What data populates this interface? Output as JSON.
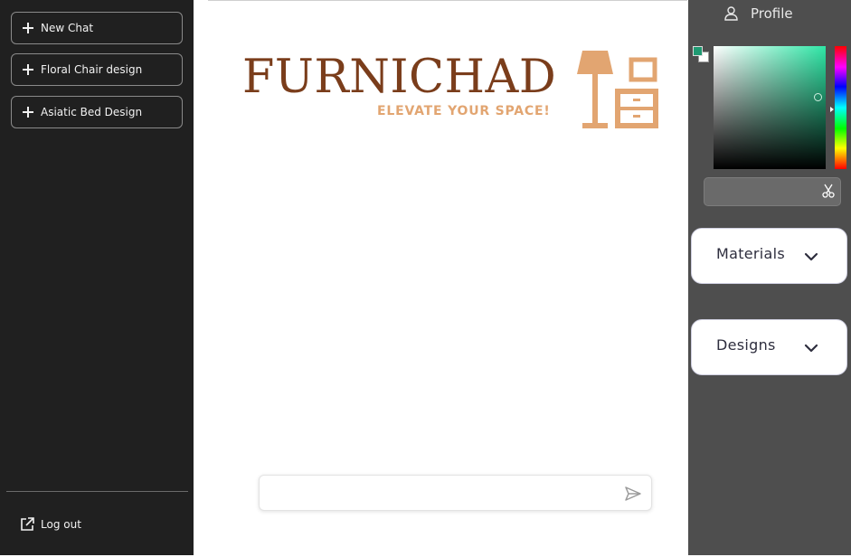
{
  "sidebar": {
    "chats": [
      {
        "label": "New Chat"
      },
      {
        "label": "Floral Chair design"
      },
      {
        "label": "Asiatic Bed Design"
      }
    ],
    "logout_label": "Log out"
  },
  "logo": {
    "brand": "FURNICHAD",
    "tagline": "ELEVATE YOUR SPACE!",
    "brand_color": "#7a3d1b",
    "accent_color": "#e2a571"
  },
  "composer": {
    "value": "",
    "placeholder": "",
    "send_icon": "send-icon"
  },
  "right_panel": {
    "profile_label": "Profile",
    "color_picker": {
      "foreground_color": "#1f9a72",
      "background_color": "#ffffff",
      "hex_value": ""
    },
    "sections": [
      {
        "label": "Materials"
      },
      {
        "label": "Designs"
      }
    ]
  },
  "colors": {
    "sidebar_bg": "#202020",
    "right_panel_bg": "#4e4e4e",
    "main_bg": "#ffffff"
  }
}
